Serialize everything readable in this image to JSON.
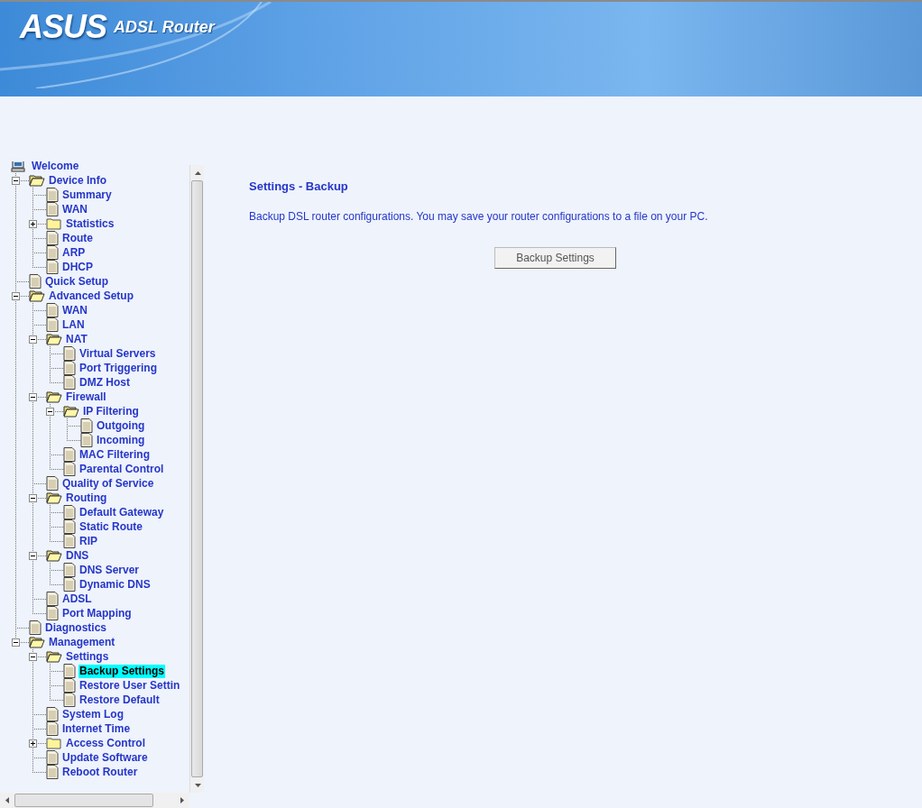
{
  "header": {
    "logo": "ASUS",
    "product": "ADSL Router"
  },
  "nav_tree": {
    "root": {
      "label": "Welcome",
      "selected": false,
      "children": [
        {
          "label": "Device Info",
          "kind": "folder",
          "expanded": true,
          "selected": false,
          "children": [
            {
              "label": "Summary",
              "kind": "page",
              "selected": false
            },
            {
              "label": "WAN",
              "kind": "page",
              "selected": false
            },
            {
              "label": "Statistics",
              "kind": "folder",
              "expanded": false,
              "selected": false
            },
            {
              "label": "Route",
              "kind": "page",
              "selected": false
            },
            {
              "label": "ARP",
              "kind": "page",
              "selected": false
            },
            {
              "label": "DHCP",
              "kind": "page",
              "selected": false
            }
          ]
        },
        {
          "label": "Quick Setup",
          "kind": "page",
          "selected": false
        },
        {
          "label": "Advanced Setup",
          "kind": "folder",
          "expanded": true,
          "selected": false,
          "children": [
            {
              "label": "WAN",
              "kind": "page",
              "selected": false
            },
            {
              "label": "LAN",
              "kind": "page",
              "selected": false
            },
            {
              "label": "NAT",
              "kind": "folder",
              "expanded": true,
              "selected": false,
              "children": [
                {
                  "label": "Virtual Servers",
                  "kind": "page",
                  "selected": false
                },
                {
                  "label": "Port Triggering",
                  "kind": "page",
                  "selected": false
                },
                {
                  "label": "DMZ Host",
                  "kind": "page",
                  "selected": false
                }
              ]
            },
            {
              "label": "Firewall",
              "kind": "folder",
              "expanded": true,
              "selected": false,
              "children": [
                {
                  "label": "IP Filtering",
                  "kind": "folder",
                  "expanded": true,
                  "selected": false,
                  "children": [
                    {
                      "label": "Outgoing",
                      "kind": "page",
                      "selected": false
                    },
                    {
                      "label": "Incoming",
                      "kind": "page",
                      "selected": false
                    }
                  ]
                },
                {
                  "label": "MAC Filtering",
                  "kind": "page",
                  "selected": false
                },
                {
                  "label": "Parental Control",
                  "kind": "page",
                  "selected": false
                }
              ]
            },
            {
              "label": "Quality of Service",
              "kind": "page",
              "selected": false
            },
            {
              "label": "Routing",
              "kind": "folder",
              "expanded": true,
              "selected": false,
              "children": [
                {
                  "label": "Default Gateway",
                  "kind": "page",
                  "selected": false
                },
                {
                  "label": "Static Route",
                  "kind": "page",
                  "selected": false
                },
                {
                  "label": "RIP",
                  "kind": "page",
                  "selected": false
                }
              ]
            },
            {
              "label": "DNS",
              "kind": "folder",
              "expanded": true,
              "selected": false,
              "children": [
                {
                  "label": "DNS Server",
                  "kind": "page",
                  "selected": false
                },
                {
                  "label": "Dynamic DNS",
                  "kind": "page",
                  "selected": false
                }
              ]
            },
            {
              "label": "ADSL",
              "kind": "page",
              "selected": false
            },
            {
              "label": "Port Mapping",
              "kind": "page",
              "selected": false
            }
          ]
        },
        {
          "label": "Diagnostics",
          "kind": "page",
          "selected": false
        },
        {
          "label": "Management",
          "kind": "folder",
          "expanded": true,
          "selected": false,
          "children": [
            {
              "label": "Settings",
              "kind": "folder",
              "expanded": true,
              "selected": false,
              "children": [
                {
                  "label": "Backup Settings",
                  "kind": "page",
                  "selected": true
                },
                {
                  "label": "Restore User Settin",
                  "kind": "page",
                  "selected": false
                },
                {
                  "label": "Restore Default",
                  "kind": "page",
                  "selected": false
                }
              ]
            },
            {
              "label": "System Log",
              "kind": "page",
              "selected": false
            },
            {
              "label": "Internet Time",
              "kind": "page",
              "selected": false
            },
            {
              "label": "Access Control",
              "kind": "folder",
              "expanded": false,
              "selected": false
            },
            {
              "label": "Update Software",
              "kind": "page",
              "selected": false
            },
            {
              "label": "Reboot Router",
              "kind": "page",
              "selected": false
            }
          ]
        }
      ]
    }
  },
  "content": {
    "title": "Settings - Backup",
    "description": "Backup DSL router configurations. You may save your router configurations to a file on your PC.",
    "button": "Backup Settings"
  }
}
